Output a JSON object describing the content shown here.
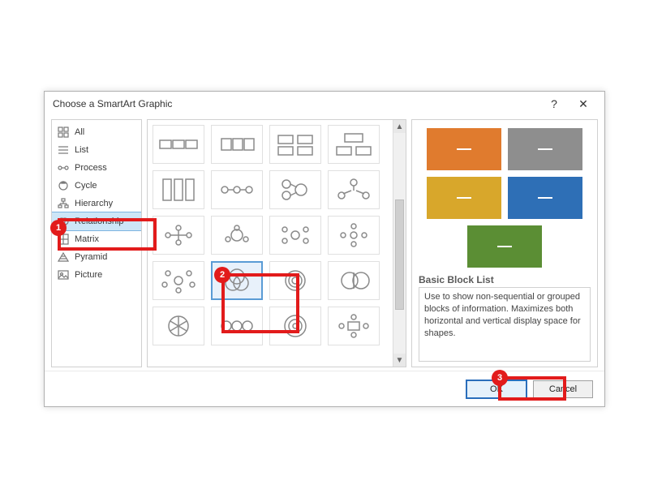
{
  "dialog": {
    "title": "Choose a SmartArt Graphic",
    "help": "?",
    "close": "✕"
  },
  "categories": [
    {
      "label": "All"
    },
    {
      "label": "List"
    },
    {
      "label": "Process"
    },
    {
      "label": "Cycle"
    },
    {
      "label": "Hierarchy"
    },
    {
      "label": "Relationship",
      "selected": true
    },
    {
      "label": "Matrix"
    },
    {
      "label": "Pyramid"
    },
    {
      "label": "Picture"
    }
  ],
  "preview": {
    "title": "Basic Block List",
    "description": "Use to show non-sequential or grouped blocks of information. Maximizes both horizontal and vertical display space for shapes.",
    "blocks": [
      {
        "color": "#e07b2e"
      },
      {
        "color": "#8e8e8e"
      },
      {
        "color": "#d8a72b"
      },
      {
        "color": "#2e6fb6"
      },
      {
        "color": "#5b8e34"
      }
    ]
  },
  "buttons": {
    "ok": "OK",
    "cancel": "Cancel"
  },
  "markers": {
    "1": "1",
    "2": "2",
    "3": "3"
  }
}
